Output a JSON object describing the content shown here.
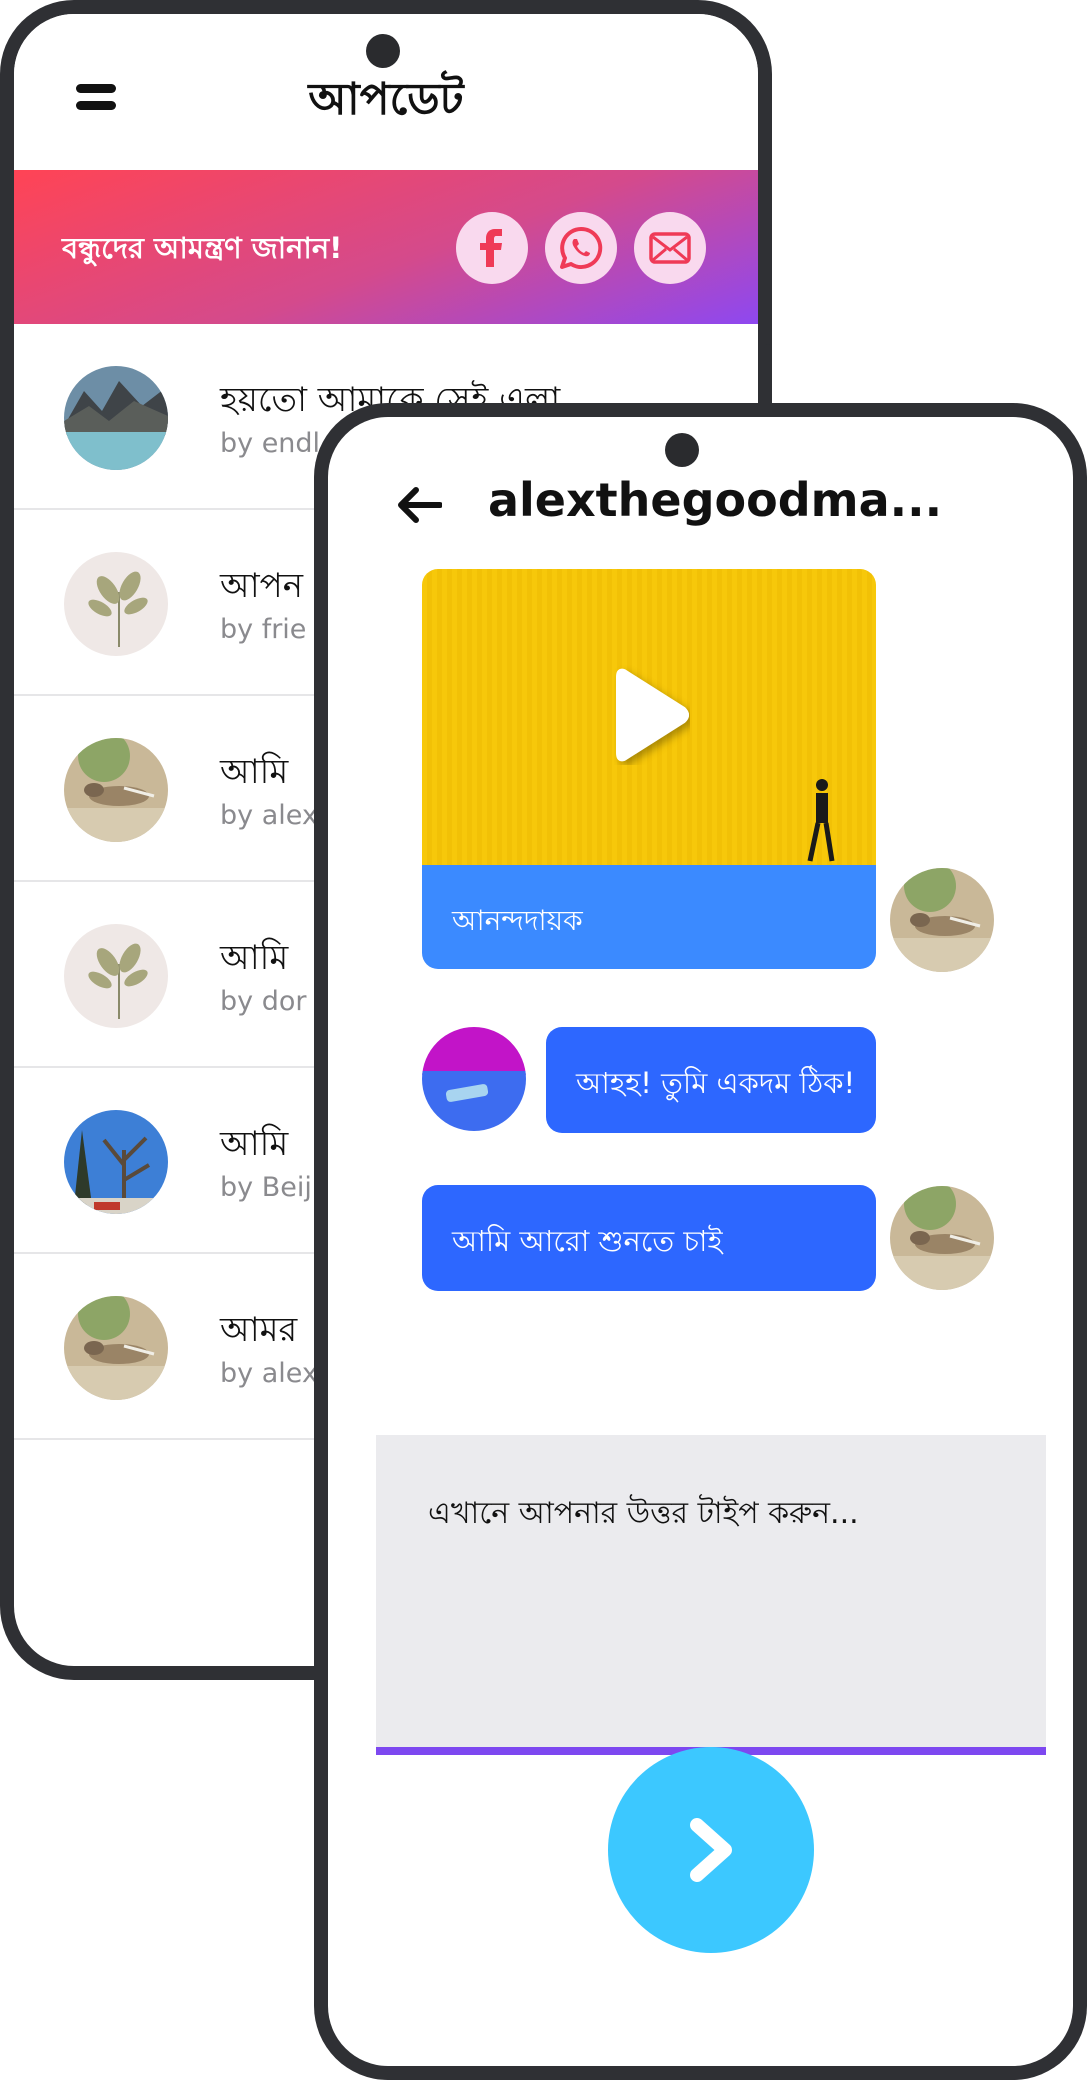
{
  "back_screen": {
    "title": "আপডেট",
    "invite": {
      "text": "বন্ধুদের আমন্ত্রণ জানান!",
      "share_buttons": [
        "facebook-icon",
        "whatsapp-icon",
        "email-icon"
      ]
    },
    "updates": [
      {
        "title": "হয়তো আমাকে সেই এলা",
        "author": "by endl",
        "thumb": "mountain-lake"
      },
      {
        "title": "আপন",
        "author": "by frie",
        "thumb": "leaf-sketch"
      },
      {
        "title": "আমি",
        "author": "by alex",
        "thumb": "chipmunk"
      },
      {
        "title": "আমি",
        "author": "by dor",
        "thumb": "leaf-sketch"
      },
      {
        "title": "আমি",
        "author": "by Beij",
        "thumb": "trees"
      },
      {
        "title": "আমর",
        "author": "by alex",
        "thumb": "chipmunk"
      }
    ]
  },
  "front_screen": {
    "title": "alexthegoodma...",
    "messages": {
      "video_caption": "আনন্দদায়ক",
      "bubble_1": "আহহ! তুমি একদম ঠিক!",
      "bubble_2": "আমি আরো শুনতে চাই"
    },
    "reply_placeholder": "এখানে আপনার উত্তর টাইপ করুন..."
  },
  "colors": {
    "banner_start": "#ff4455",
    "banner_end": "#8e48f0",
    "bubble": "#2d67ff",
    "caption_bar": "#3b8aff",
    "send_button": "#3cc8ff",
    "input_underline": "#7d48f0"
  }
}
